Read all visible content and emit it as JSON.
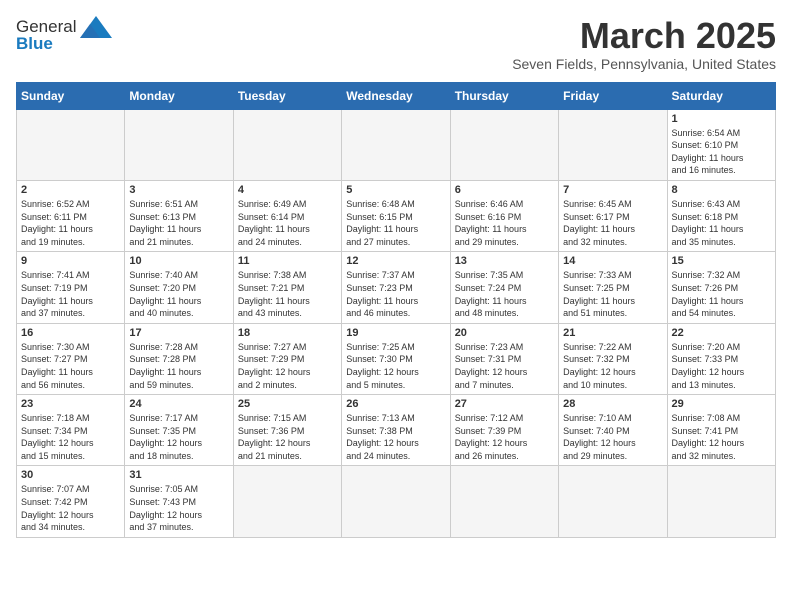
{
  "header": {
    "logo_general": "General",
    "logo_blue": "Blue",
    "month_title": "March 2025",
    "location": "Seven Fields, Pennsylvania, United States"
  },
  "days_of_week": [
    "Sunday",
    "Monday",
    "Tuesday",
    "Wednesday",
    "Thursday",
    "Friday",
    "Saturday"
  ],
  "weeks": [
    [
      {
        "day": "",
        "info": "",
        "empty": true
      },
      {
        "day": "",
        "info": "",
        "empty": true
      },
      {
        "day": "",
        "info": "",
        "empty": true
      },
      {
        "day": "",
        "info": "",
        "empty": true
      },
      {
        "day": "",
        "info": "",
        "empty": true
      },
      {
        "day": "",
        "info": "",
        "empty": true
      },
      {
        "day": "1",
        "info": "Sunrise: 6:54 AM\nSunset: 6:10 PM\nDaylight: 11 hours\nand 16 minutes.",
        "empty": false
      }
    ],
    [
      {
        "day": "2",
        "info": "Sunrise: 6:52 AM\nSunset: 6:11 PM\nDaylight: 11 hours\nand 19 minutes.",
        "empty": false
      },
      {
        "day": "3",
        "info": "Sunrise: 6:51 AM\nSunset: 6:13 PM\nDaylight: 11 hours\nand 21 minutes.",
        "empty": false
      },
      {
        "day": "4",
        "info": "Sunrise: 6:49 AM\nSunset: 6:14 PM\nDaylight: 11 hours\nand 24 minutes.",
        "empty": false
      },
      {
        "day": "5",
        "info": "Sunrise: 6:48 AM\nSunset: 6:15 PM\nDaylight: 11 hours\nand 27 minutes.",
        "empty": false
      },
      {
        "day": "6",
        "info": "Sunrise: 6:46 AM\nSunset: 6:16 PM\nDaylight: 11 hours\nand 29 minutes.",
        "empty": false
      },
      {
        "day": "7",
        "info": "Sunrise: 6:45 AM\nSunset: 6:17 PM\nDaylight: 11 hours\nand 32 minutes.",
        "empty": false
      },
      {
        "day": "8",
        "info": "Sunrise: 6:43 AM\nSunset: 6:18 PM\nDaylight: 11 hours\nand 35 minutes.",
        "empty": false
      }
    ],
    [
      {
        "day": "9",
        "info": "Sunrise: 7:41 AM\nSunset: 7:19 PM\nDaylight: 11 hours\nand 37 minutes.",
        "empty": false
      },
      {
        "day": "10",
        "info": "Sunrise: 7:40 AM\nSunset: 7:20 PM\nDaylight: 11 hours\nand 40 minutes.",
        "empty": false
      },
      {
        "day": "11",
        "info": "Sunrise: 7:38 AM\nSunset: 7:21 PM\nDaylight: 11 hours\nand 43 minutes.",
        "empty": false
      },
      {
        "day": "12",
        "info": "Sunrise: 7:37 AM\nSunset: 7:23 PM\nDaylight: 11 hours\nand 46 minutes.",
        "empty": false
      },
      {
        "day": "13",
        "info": "Sunrise: 7:35 AM\nSunset: 7:24 PM\nDaylight: 11 hours\nand 48 minutes.",
        "empty": false
      },
      {
        "day": "14",
        "info": "Sunrise: 7:33 AM\nSunset: 7:25 PM\nDaylight: 11 hours\nand 51 minutes.",
        "empty": false
      },
      {
        "day": "15",
        "info": "Sunrise: 7:32 AM\nSunset: 7:26 PM\nDaylight: 11 hours\nand 54 minutes.",
        "empty": false
      }
    ],
    [
      {
        "day": "16",
        "info": "Sunrise: 7:30 AM\nSunset: 7:27 PM\nDaylight: 11 hours\nand 56 minutes.",
        "empty": false
      },
      {
        "day": "17",
        "info": "Sunrise: 7:28 AM\nSunset: 7:28 PM\nDaylight: 11 hours\nand 59 minutes.",
        "empty": false
      },
      {
        "day": "18",
        "info": "Sunrise: 7:27 AM\nSunset: 7:29 PM\nDaylight: 12 hours\nand 2 minutes.",
        "empty": false
      },
      {
        "day": "19",
        "info": "Sunrise: 7:25 AM\nSunset: 7:30 PM\nDaylight: 12 hours\nand 5 minutes.",
        "empty": false
      },
      {
        "day": "20",
        "info": "Sunrise: 7:23 AM\nSunset: 7:31 PM\nDaylight: 12 hours\nand 7 minutes.",
        "empty": false
      },
      {
        "day": "21",
        "info": "Sunrise: 7:22 AM\nSunset: 7:32 PM\nDaylight: 12 hours\nand 10 minutes.",
        "empty": false
      },
      {
        "day": "22",
        "info": "Sunrise: 7:20 AM\nSunset: 7:33 PM\nDaylight: 12 hours\nand 13 minutes.",
        "empty": false
      }
    ],
    [
      {
        "day": "23",
        "info": "Sunrise: 7:18 AM\nSunset: 7:34 PM\nDaylight: 12 hours\nand 15 minutes.",
        "empty": false
      },
      {
        "day": "24",
        "info": "Sunrise: 7:17 AM\nSunset: 7:35 PM\nDaylight: 12 hours\nand 18 minutes.",
        "empty": false
      },
      {
        "day": "25",
        "info": "Sunrise: 7:15 AM\nSunset: 7:36 PM\nDaylight: 12 hours\nand 21 minutes.",
        "empty": false
      },
      {
        "day": "26",
        "info": "Sunrise: 7:13 AM\nSunset: 7:38 PM\nDaylight: 12 hours\nand 24 minutes.",
        "empty": false
      },
      {
        "day": "27",
        "info": "Sunrise: 7:12 AM\nSunset: 7:39 PM\nDaylight: 12 hours\nand 26 minutes.",
        "empty": false
      },
      {
        "day": "28",
        "info": "Sunrise: 7:10 AM\nSunset: 7:40 PM\nDaylight: 12 hours\nand 29 minutes.",
        "empty": false
      },
      {
        "day": "29",
        "info": "Sunrise: 7:08 AM\nSunset: 7:41 PM\nDaylight: 12 hours\nand 32 minutes.",
        "empty": false
      }
    ],
    [
      {
        "day": "30",
        "info": "Sunrise: 7:07 AM\nSunset: 7:42 PM\nDaylight: 12 hours\nand 34 minutes.",
        "empty": false
      },
      {
        "day": "31",
        "info": "Sunrise: 7:05 AM\nSunset: 7:43 PM\nDaylight: 12 hours\nand 37 minutes.",
        "empty": false
      },
      {
        "day": "",
        "info": "",
        "empty": true
      },
      {
        "day": "",
        "info": "",
        "empty": true
      },
      {
        "day": "",
        "info": "",
        "empty": true
      },
      {
        "day": "",
        "info": "",
        "empty": true
      },
      {
        "day": "",
        "info": "",
        "empty": true
      }
    ]
  ]
}
